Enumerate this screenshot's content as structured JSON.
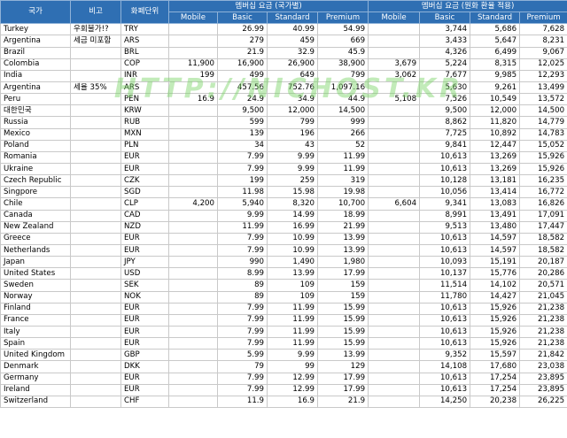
{
  "headers": {
    "country": "국가",
    "note": "비고",
    "currency": "화폐단위",
    "group_local": "멤버십 요금 (국가별)",
    "group_krw": "멤버십 요금 (원화 환율 적용)",
    "mobile": "Mobile",
    "basic": "Basic",
    "standard": "Standard",
    "premium": "Premium"
  },
  "watermark": "HTTP://NICHOST.KR",
  "rows": [
    {
      "country": "Turkey",
      "note": "우회불가!?",
      "cur": "TRY",
      "m": "",
      "b": "26.99",
      "s": "40.99",
      "p": "54.99",
      "km": "",
      "kb": "3,744",
      "ks": "5,686",
      "kp": "7,628"
    },
    {
      "country": "Argentina",
      "note": "세금 미포함",
      "cur": "ARS",
      "m": "",
      "b": "279",
      "s": "459",
      "p": "669",
      "km": "",
      "kb": "3,433",
      "ks": "5,647",
      "kp": "8,231"
    },
    {
      "country": "Brazil",
      "note": "",
      "cur": "BRL",
      "m": "",
      "b": "21.9",
      "s": "32.9",
      "p": "45.9",
      "km": "",
      "kb": "4,326",
      "ks": "6,499",
      "kp": "9,067"
    },
    {
      "country": "Colombia",
      "note": "",
      "cur": "COP",
      "m": "11,900",
      "b": "16,900",
      "s": "26,900",
      "p": "38,900",
      "km": "3,679",
      "kb": "5,224",
      "ks": "8,315",
      "kp": "12,025"
    },
    {
      "country": "India",
      "note": "",
      "cur": "INR",
      "m": "199",
      "b": "499",
      "s": "649",
      "p": "799",
      "km": "3,062",
      "kb": "7,677",
      "ks": "9,985",
      "kp": "12,293"
    },
    {
      "country": "Argentina",
      "note": "세율 35%",
      "cur": "ARS",
      "m": "",
      "b": "457.56",
      "s": "752.76",
      "p": "1,097.16",
      "km": "",
      "kb": "5,630",
      "ks": "9,261",
      "kp": "13,499"
    },
    {
      "country": "Peru",
      "note": "",
      "cur": "PEN",
      "m": "16.9",
      "b": "24.9",
      "s": "34.9",
      "p": "44.9",
      "km": "5,108",
      "kb": "7,526",
      "ks": "10,549",
      "kp": "13,572"
    },
    {
      "country": "대한민국",
      "note": "",
      "cur": "KRW",
      "m": "",
      "b": "9,500",
      "s": "12,000",
      "p": "14,500",
      "km": "",
      "kb": "9,500",
      "ks": "12,000",
      "kp": "14,500"
    },
    {
      "country": "Russia",
      "note": "",
      "cur": "RUB",
      "m": "",
      "b": "599",
      "s": "799",
      "p": "999",
      "km": "",
      "kb": "8,862",
      "ks": "11,820",
      "kp": "14,779"
    },
    {
      "country": "Mexico",
      "note": "",
      "cur": "MXN",
      "m": "",
      "b": "139",
      "s": "196",
      "p": "266",
      "km": "",
      "kb": "7,725",
      "ks": "10,892",
      "kp": "14,783"
    },
    {
      "country": "Poland",
      "note": "",
      "cur": "PLN",
      "m": "",
      "b": "34",
      "s": "43",
      "p": "52",
      "km": "",
      "kb": "9,841",
      "ks": "12,447",
      "kp": "15,052"
    },
    {
      "country": "Romania",
      "note": "",
      "cur": "EUR",
      "m": "",
      "b": "7.99",
      "s": "9.99",
      "p": "11.99",
      "km": "",
      "kb": "10,613",
      "ks": "13,269",
      "kp": "15,926"
    },
    {
      "country": "Ukraine",
      "note": "",
      "cur": "EUR",
      "m": "",
      "b": "7.99",
      "s": "9.99",
      "p": "11.99",
      "km": "",
      "kb": "10,613",
      "ks": "13,269",
      "kp": "15,926"
    },
    {
      "country": "Czech Republic",
      "note": "",
      "cur": "CZK",
      "m": "",
      "b": "199",
      "s": "259",
      "p": "319",
      "km": "",
      "kb": "10,128",
      "ks": "13,181",
      "kp": "16,235"
    },
    {
      "country": "Singpore",
      "note": "",
      "cur": "SGD",
      "m": "",
      "b": "11.98",
      "s": "15.98",
      "p": "19.98",
      "km": "",
      "kb": "10,056",
      "ks": "13,414",
      "kp": "16,772"
    },
    {
      "country": "Chile",
      "note": "",
      "cur": "CLP",
      "m": "4,200",
      "b": "5,940",
      "s": "8,320",
      "p": "10,700",
      "km": "6,604",
      "kb": "9,341",
      "ks": "13,083",
      "kp": "16,826"
    },
    {
      "country": "Canada",
      "note": "",
      "cur": "CAD",
      "m": "",
      "b": "9.99",
      "s": "14.99",
      "p": "18.99",
      "km": "",
      "kb": "8,991",
      "ks": "13,491",
      "kp": "17,091"
    },
    {
      "country": "New Zealand",
      "note": "",
      "cur": "NZD",
      "m": "",
      "b": "11.99",
      "s": "16.99",
      "p": "21.99",
      "km": "",
      "kb": "9,513",
      "ks": "13,480",
      "kp": "17,447"
    },
    {
      "country": "Greece",
      "note": "",
      "cur": "EUR",
      "m": "",
      "b": "7.99",
      "s": "10.99",
      "p": "13.99",
      "km": "",
      "kb": "10,613",
      "ks": "14,597",
      "kp": "18,582"
    },
    {
      "country": "Netherlands",
      "note": "",
      "cur": "EUR",
      "m": "",
      "b": "7.99",
      "s": "10.99",
      "p": "13.99",
      "km": "",
      "kb": "10,613",
      "ks": "14,597",
      "kp": "18,582"
    },
    {
      "country": "Japan",
      "note": "",
      "cur": "JPY",
      "m": "",
      "b": "990",
      "s": "1,490",
      "p": "1,980",
      "km": "",
      "kb": "10,093",
      "ks": "15,191",
      "kp": "20,187"
    },
    {
      "country": "United States",
      "note": "",
      "cur": "USD",
      "m": "",
      "b": "8.99",
      "s": "13.99",
      "p": "17.99",
      "km": "",
      "kb": "10,137",
      "ks": "15,776",
      "kp": "20,286"
    },
    {
      "country": "Sweden",
      "note": "",
      "cur": "SEK",
      "m": "",
      "b": "89",
      "s": "109",
      "p": "159",
      "km": "",
      "kb": "11,514",
      "ks": "14,102",
      "kp": "20,571"
    },
    {
      "country": "Norway",
      "note": "",
      "cur": "NOK",
      "m": "",
      "b": "89",
      "s": "109",
      "p": "159",
      "km": "",
      "kb": "11,780",
      "ks": "14,427",
      "kp": "21,045"
    },
    {
      "country": "Finland",
      "note": "",
      "cur": "EUR",
      "m": "",
      "b": "7.99",
      "s": "11.99",
      "p": "15.99",
      "km": "",
      "kb": "10,613",
      "ks": "15,926",
      "kp": "21,238"
    },
    {
      "country": "France",
      "note": "",
      "cur": "EUR",
      "m": "",
      "b": "7.99",
      "s": "11.99",
      "p": "15.99",
      "km": "",
      "kb": "10,613",
      "ks": "15,926",
      "kp": "21,238"
    },
    {
      "country": "Italy",
      "note": "",
      "cur": "EUR",
      "m": "",
      "b": "7.99",
      "s": "11.99",
      "p": "15.99",
      "km": "",
      "kb": "10,613",
      "ks": "15,926",
      "kp": "21,238"
    },
    {
      "country": "Spain",
      "note": "",
      "cur": "EUR",
      "m": "",
      "b": "7.99",
      "s": "11.99",
      "p": "15.99",
      "km": "",
      "kb": "10,613",
      "ks": "15,926",
      "kp": "21,238"
    },
    {
      "country": "United Kingdom",
      "note": "",
      "cur": "GBP",
      "m": "",
      "b": "5.99",
      "s": "9.99",
      "p": "13.99",
      "km": "",
      "kb": "9,352",
      "ks": "15,597",
      "kp": "21,842"
    },
    {
      "country": "Denmark",
      "note": "",
      "cur": "DKK",
      "m": "",
      "b": "79",
      "s": "99",
      "p": "129",
      "km": "",
      "kb": "14,108",
      "ks": "17,680",
      "kp": "23,038"
    },
    {
      "country": "Germany",
      "note": "",
      "cur": "EUR",
      "m": "",
      "b": "7.99",
      "s": "12.99",
      "p": "17.99",
      "km": "",
      "kb": "10,613",
      "ks": "17,254",
      "kp": "23,895"
    },
    {
      "country": "Ireland",
      "note": "",
      "cur": "EUR",
      "m": "",
      "b": "7.99",
      "s": "12.99",
      "p": "17.99",
      "km": "",
      "kb": "10,613",
      "ks": "17,254",
      "kp": "23,895"
    },
    {
      "country": "Switzerland",
      "note": "",
      "cur": "CHF",
      "m": "",
      "b": "11.9",
      "s": "16.9",
      "p": "21.9",
      "km": "",
      "kb": "14,250",
      "ks": "20,238",
      "kp": "26,225"
    }
  ]
}
